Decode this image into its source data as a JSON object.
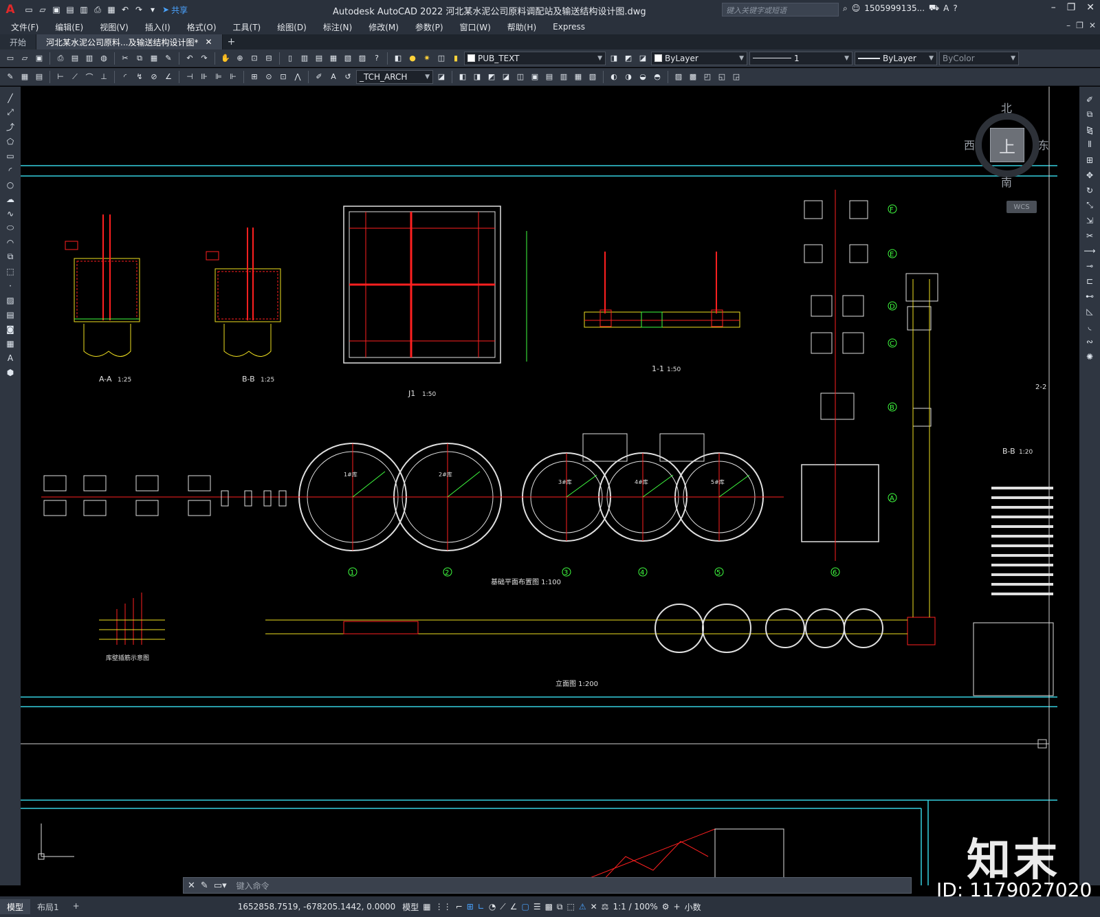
{
  "app": {
    "logo": "A",
    "title": "Autodesk AutoCAD 2022    河北某水泥公司原料调配站及输送结构设计图.dwg",
    "share_label": "共享",
    "search_placeholder": "键入关键字或短语",
    "user": "1505999135...",
    "window_controls": [
      "–",
      "❐",
      "✕"
    ]
  },
  "menu": [
    "文件(F)",
    "编辑(E)",
    "视图(V)",
    "插入(I)",
    "格式(O)",
    "工具(T)",
    "绘图(D)",
    "标注(N)",
    "修改(M)",
    "参数(P)",
    "窗口(W)",
    "帮助(H)",
    "Express"
  ],
  "tabs": [
    {
      "label": "开始",
      "active": false
    },
    {
      "label": "河北某水泥公司原料...及输送结构设计图*",
      "active": true,
      "close": "✕"
    }
  ],
  "toolbar": {
    "text_style": "PUB_TEXT",
    "layer_color": "ByLayer",
    "lineweight_value": "1",
    "linetype": "ByLayer",
    "plot_style": "ByColor",
    "dim_style": "_TCH_ARCH"
  },
  "viewcube": {
    "north": "北",
    "south": "南",
    "east": "东",
    "west": "西",
    "top_face": "上",
    "wcs": "WCS"
  },
  "drawing": {
    "views": [
      {
        "label": "A-A",
        "scale": "1:25"
      },
      {
        "label": "B-B",
        "scale": "1:25"
      },
      {
        "label": "J1",
        "scale": "1:50"
      },
      {
        "label": "1-1",
        "scale": "1:50"
      },
      {
        "label": "B-B",
        "scale": "1:20"
      },
      {
        "label": "2-2",
        "scale": ""
      }
    ],
    "plan_title": "基础平面布置图 1:100",
    "elevation_title": "立面图 1:200",
    "rebar_title": "库壁插筋示意图",
    "silo_labels": [
      "1#库",
      "2#库",
      "3#库",
      "4#库",
      "5#库"
    ],
    "axis_numbers": [
      "1",
      "2",
      "3",
      "4",
      "5",
      "6"
    ],
    "axis_letters": [
      "F",
      "E",
      "D",
      "C",
      "B",
      "A"
    ]
  },
  "command": {
    "placeholder": "键入命令"
  },
  "status": {
    "layout_tabs": [
      "模型",
      "布局1"
    ],
    "add_layout": "+",
    "coordinates": "1652858.7519, -678205.1442, 0.0000",
    "mode": "模型",
    "scale": "1:1 / 100%",
    "units": "小数"
  },
  "watermark": {
    "brand": "知末",
    "id": "ID: 1179027020"
  }
}
